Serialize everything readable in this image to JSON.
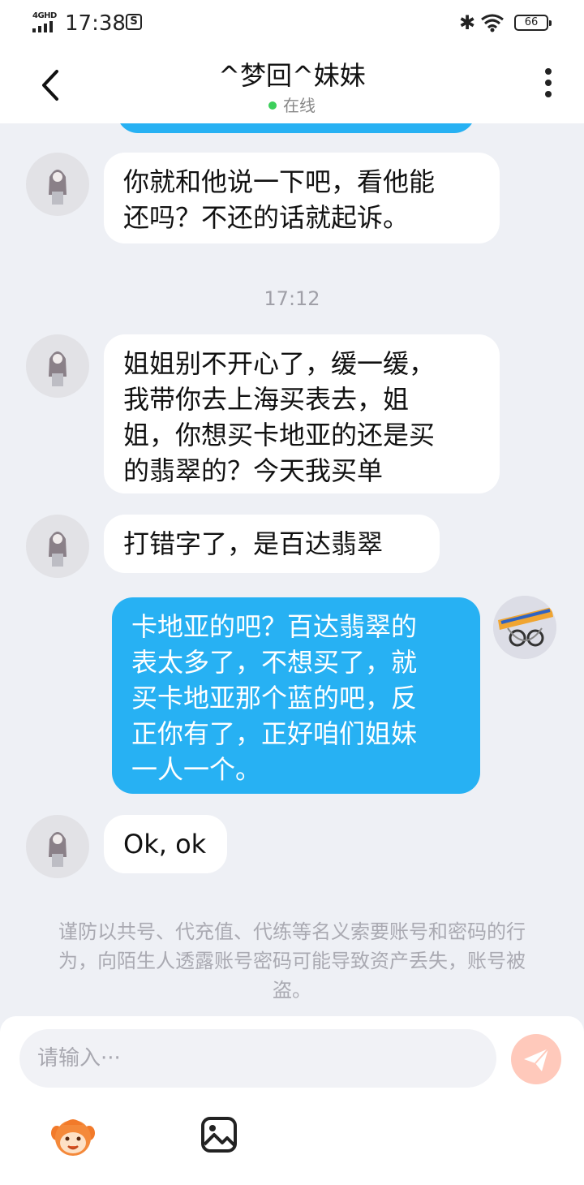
{
  "status_bar": {
    "network": "4GHD",
    "time": "17:38",
    "notification": "S",
    "battery": "66"
  },
  "header": {
    "title": "^梦回^妹妹",
    "status": "在线"
  },
  "messages": [
    {
      "from": "other",
      "text": "你就和他说一下吧，看他能\n还吗？不还的话就起诉。"
    },
    {
      "type": "time",
      "text": "17:12"
    },
    {
      "from": "other",
      "text": "姐姐别不开心了，缓一缓，\n我带你去上海买表去，姐\n姐，你想买卡地亚的还是买\n的翡翠的？今天我买单"
    },
    {
      "from": "other",
      "text": "打错字了，是百达翡翠"
    },
    {
      "from": "me",
      "text": "卡地亚的吧？百达翡翠的\n表太多了，不想买了，就\n买卡地亚那个蓝的吧，反\n正你有了，正好咱们姐妹\n一人一个。"
    },
    {
      "from": "other",
      "text": "Ok, ok"
    }
  ],
  "notice": "谨防以共号、代充值、代练等名义索要账号和密码的行为，向陌生人透露账号密码可能导致资产丢失，账号被盗。",
  "input": {
    "placeholder": "请输入···"
  },
  "icons": {
    "back": "back-arrow-icon",
    "more": "more-vertical-icon",
    "send": "send-icon",
    "emoji": "emoji-icon",
    "image": "image-icon"
  },
  "colors": {
    "outgoing_bubble": "#27b1f3",
    "incoming_bubble": "#ffffff",
    "background": "#eef0f5",
    "online_dot": "#3ccf5b",
    "send_button": "#ffc9bb"
  }
}
